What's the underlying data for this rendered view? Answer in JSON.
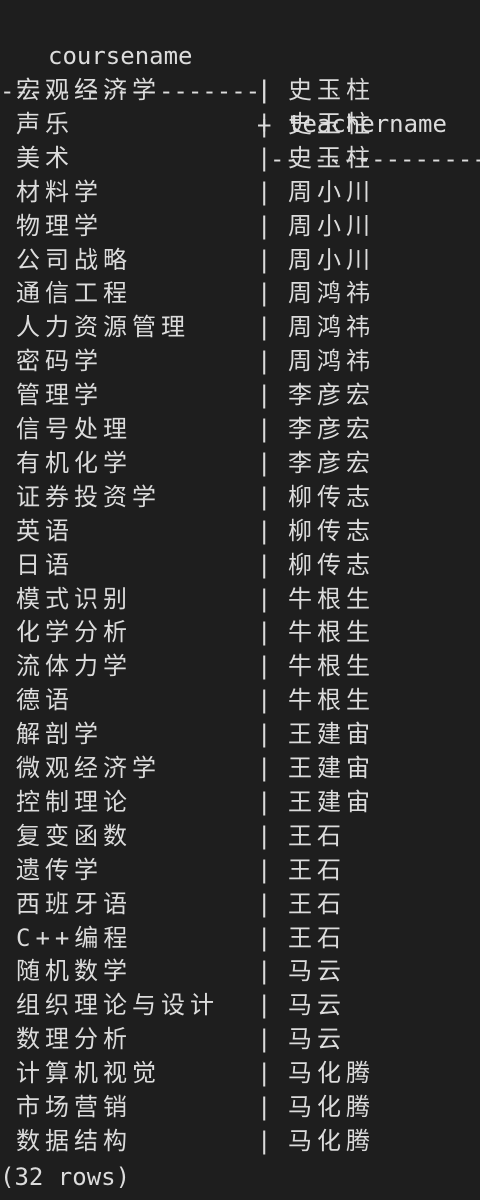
{
  "table": {
    "columns": [
      "coursename",
      "teachername"
    ],
    "separator": "|",
    "divider_left": "------------------------------",
    "divider_plus": "+",
    "divider_right": "------------------------------",
    "rows": [
      {
        "course": "宏观经济学",
        "teacher": "史玉柱"
      },
      {
        "course": "声乐",
        "teacher": "史玉柱"
      },
      {
        "course": "美术",
        "teacher": "史玉柱"
      },
      {
        "course": "材料学",
        "teacher": "周小川"
      },
      {
        "course": "物理学",
        "teacher": "周小川"
      },
      {
        "course": "公司战略",
        "teacher": "周小川"
      },
      {
        "course": "通信工程",
        "teacher": "周鸿祎"
      },
      {
        "course": "人力资源管理",
        "teacher": "周鸿祎"
      },
      {
        "course": "密码学",
        "teacher": "周鸿祎"
      },
      {
        "course": "管理学",
        "teacher": "李彦宏"
      },
      {
        "course": "信号处理",
        "teacher": "李彦宏"
      },
      {
        "course": "有机化学",
        "teacher": "李彦宏"
      },
      {
        "course": "证券投资学",
        "teacher": "柳传志"
      },
      {
        "course": "英语",
        "teacher": "柳传志"
      },
      {
        "course": "日语",
        "teacher": "柳传志"
      },
      {
        "course": "模式识别",
        "teacher": "牛根生"
      },
      {
        "course": "化学分析",
        "teacher": "牛根生"
      },
      {
        "course": "流体力学",
        "teacher": "牛根生"
      },
      {
        "course": "德语",
        "teacher": "牛根生"
      },
      {
        "course": "解剖学",
        "teacher": "王建宙"
      },
      {
        "course": "微观经济学",
        "teacher": "王建宙"
      },
      {
        "course": "控制理论",
        "teacher": "王建宙"
      },
      {
        "course": "复变函数",
        "teacher": "王石"
      },
      {
        "course": "遗传学",
        "teacher": "王石"
      },
      {
        "course": "西班牙语",
        "teacher": "王石"
      },
      {
        "course": "C++编程",
        "teacher": "王石"
      },
      {
        "course": "随机数学",
        "teacher": "马云"
      },
      {
        "course": "组织理论与设计",
        "teacher": "马云"
      },
      {
        "course": "数理分析",
        "teacher": "马云"
      },
      {
        "course": "计算机视觉",
        "teacher": "马化腾"
      },
      {
        "course": "市场营销",
        "teacher": "马化腾"
      },
      {
        "course": "数据结构",
        "teacher": "马化腾"
      }
    ],
    "row_count_text": "(32 rows)"
  },
  "colors": {
    "background": "#1e1e1e",
    "text": "#dcdcdc"
  }
}
